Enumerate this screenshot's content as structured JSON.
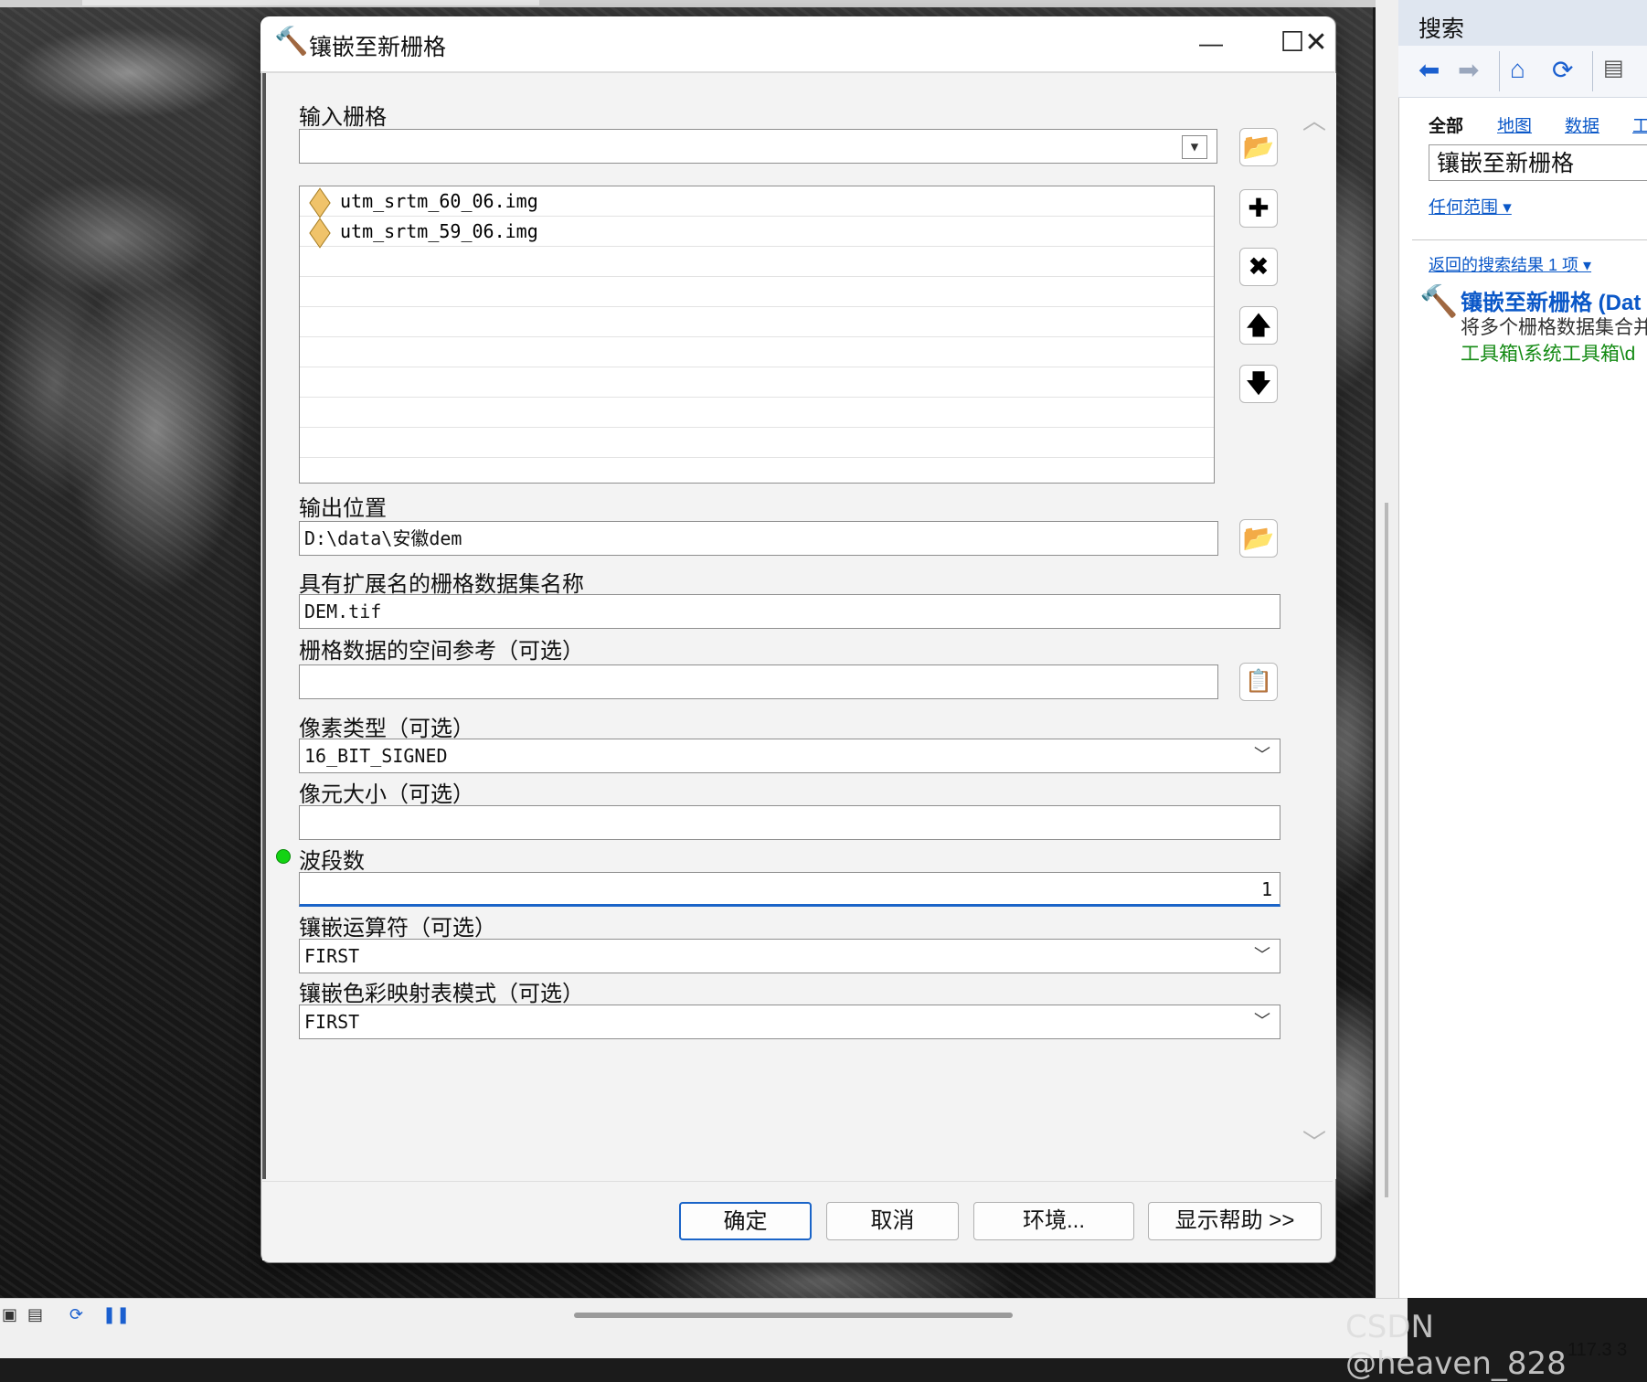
{
  "dialog": {
    "title": "镶嵌至新栅格",
    "window_controls": {
      "minimize": "—",
      "maximize": "☐",
      "close": "✕"
    },
    "fields": {
      "input_rasters": {
        "label": "输入栅格",
        "value": "",
        "items": [
          "utm_srtm_60_06.img",
          "utm_srtm_59_06.img"
        ]
      },
      "output_location": {
        "label": "输出位置",
        "value": "D:\\data\\安徽dem"
      },
      "dataset_name": {
        "label": "具有扩展名的栅格数据集名称",
        "value": "DEM.tif"
      },
      "spatial_ref": {
        "label": "栅格数据的空间参考（可选）",
        "value": ""
      },
      "pixel_type": {
        "label": "像素类型（可选）",
        "value": "16_BIT_SIGNED"
      },
      "cell_size": {
        "label": "像元大小（可选）",
        "value": ""
      },
      "band_count": {
        "label": "波段数",
        "value": "1"
      },
      "mosaic_operator": {
        "label": "镶嵌运算符（可选）",
        "value": "FIRST"
      },
      "colormap_mode": {
        "label": "镶嵌色彩映射表模式（可选）",
        "value": "FIRST"
      }
    },
    "buttons": {
      "ok": "确定",
      "cancel": "取消",
      "env": "环境...",
      "help": "显示帮助 >>"
    }
  },
  "search_panel": {
    "title": "搜索",
    "tabs": [
      "全部",
      "地图",
      "数据",
      "工"
    ],
    "query": "镶嵌至新栅格",
    "extent": "任何范围 ▾",
    "result_count": "返回的搜索结果 1 项 ▾",
    "result": {
      "title": "镶嵌至新栅格 (Dat",
      "description": "将多个栅格数据集合并",
      "path": "工具箱\\系统工具箱\\d"
    }
  },
  "status": {
    "coordinates": "117.3  3",
    "watermark": "CSDN @heaven_828"
  },
  "icons": {
    "dialog": "hammer-icon",
    "browse": "folder-open-icon",
    "add": "plus-icon",
    "remove": "x-icon",
    "up": "arrow-up-icon",
    "down": "arrow-down-icon"
  }
}
